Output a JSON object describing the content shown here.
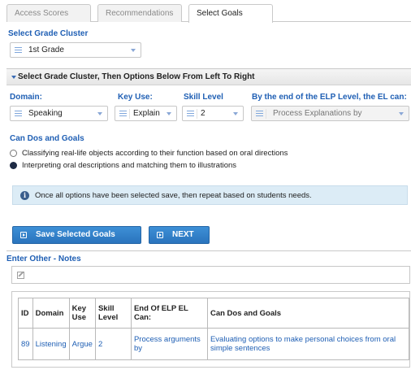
{
  "tabs": [
    {
      "label": "Access Scores",
      "active": false
    },
    {
      "label": "Recommendations",
      "active": false
    },
    {
      "label": "Select Goals",
      "active": true
    }
  ],
  "grade_cluster": {
    "label": "Select Grade Cluster",
    "value": "1st Grade"
  },
  "panel": {
    "title": "Select Grade Cluster, Then Options Below From Left To Right",
    "domain": {
      "label": "Domain:",
      "value": "Speaking"
    },
    "key_use": {
      "label": "Key Use:",
      "value": "Explain"
    },
    "skill_level": {
      "label": "Skill Level",
      "value": "2"
    },
    "end_of_level": {
      "label": "By the end of the ELP Level, the EL can:",
      "value": "Process Explanations by"
    },
    "can_dos": {
      "label": "Can Dos and Goals",
      "options": [
        {
          "text": "Classifying real-life objects according to their function based on oral directions",
          "selected": false
        },
        {
          "text": "Interpreting oral descriptions and matching them to illustrations",
          "selected": true
        }
      ]
    },
    "info_text": "Once all options have been selected save, then repeat based on students needs.",
    "save_button": "Save Selected Goals",
    "next_button": "NEXT"
  },
  "notes": {
    "label": "Enter Other - Notes",
    "value": "",
    "placeholder": ""
  },
  "goals_table": {
    "headers": [
      "ID",
      "Domain",
      "Key Use",
      "Skill Level",
      "End Of ELP EL Can:",
      "Can Dos and Goals"
    ],
    "rows": [
      [
        "89",
        "Listening",
        "Argue",
        "2",
        "Process arguments by",
        "Evaluating options to make personal choices from oral simple sentences"
      ]
    ]
  }
}
